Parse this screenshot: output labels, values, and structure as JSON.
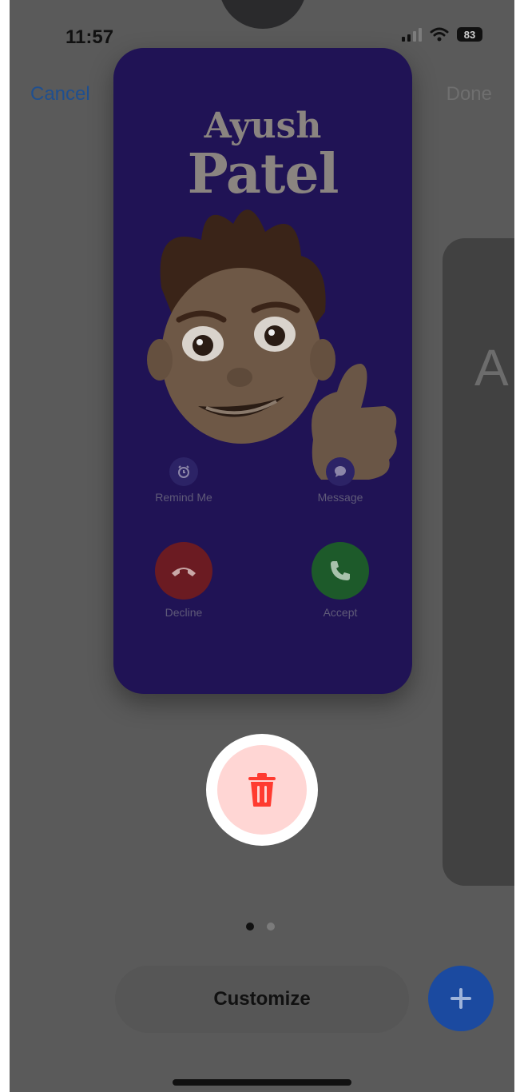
{
  "status_bar": {
    "time": "11:57",
    "battery": "83"
  },
  "nav": {
    "cancel_label": "Cancel",
    "done_label": "Done"
  },
  "poster": {
    "first_name": "Ayush",
    "last_name": "Patel",
    "actions": {
      "remind_label": "Remind Me",
      "message_label": "Message",
      "decline_label": "Decline",
      "accept_label": "Accept"
    }
  },
  "side_card": {
    "text": "A"
  },
  "pager": {
    "count": 2,
    "active_index": 0
  },
  "bottom": {
    "customize_label": "Customize"
  },
  "colors": {
    "poster_bg": "#201355",
    "trash_red": "#ff3b30",
    "accept_green": "#1d5a2a",
    "decline_red": "#6b1b22"
  },
  "icons": [
    "alarm-icon",
    "message-bubble-icon",
    "phone-down-icon",
    "phone-icon",
    "trash-icon",
    "plus-icon",
    "wifi-icon",
    "signal-icon",
    "battery-icon"
  ]
}
